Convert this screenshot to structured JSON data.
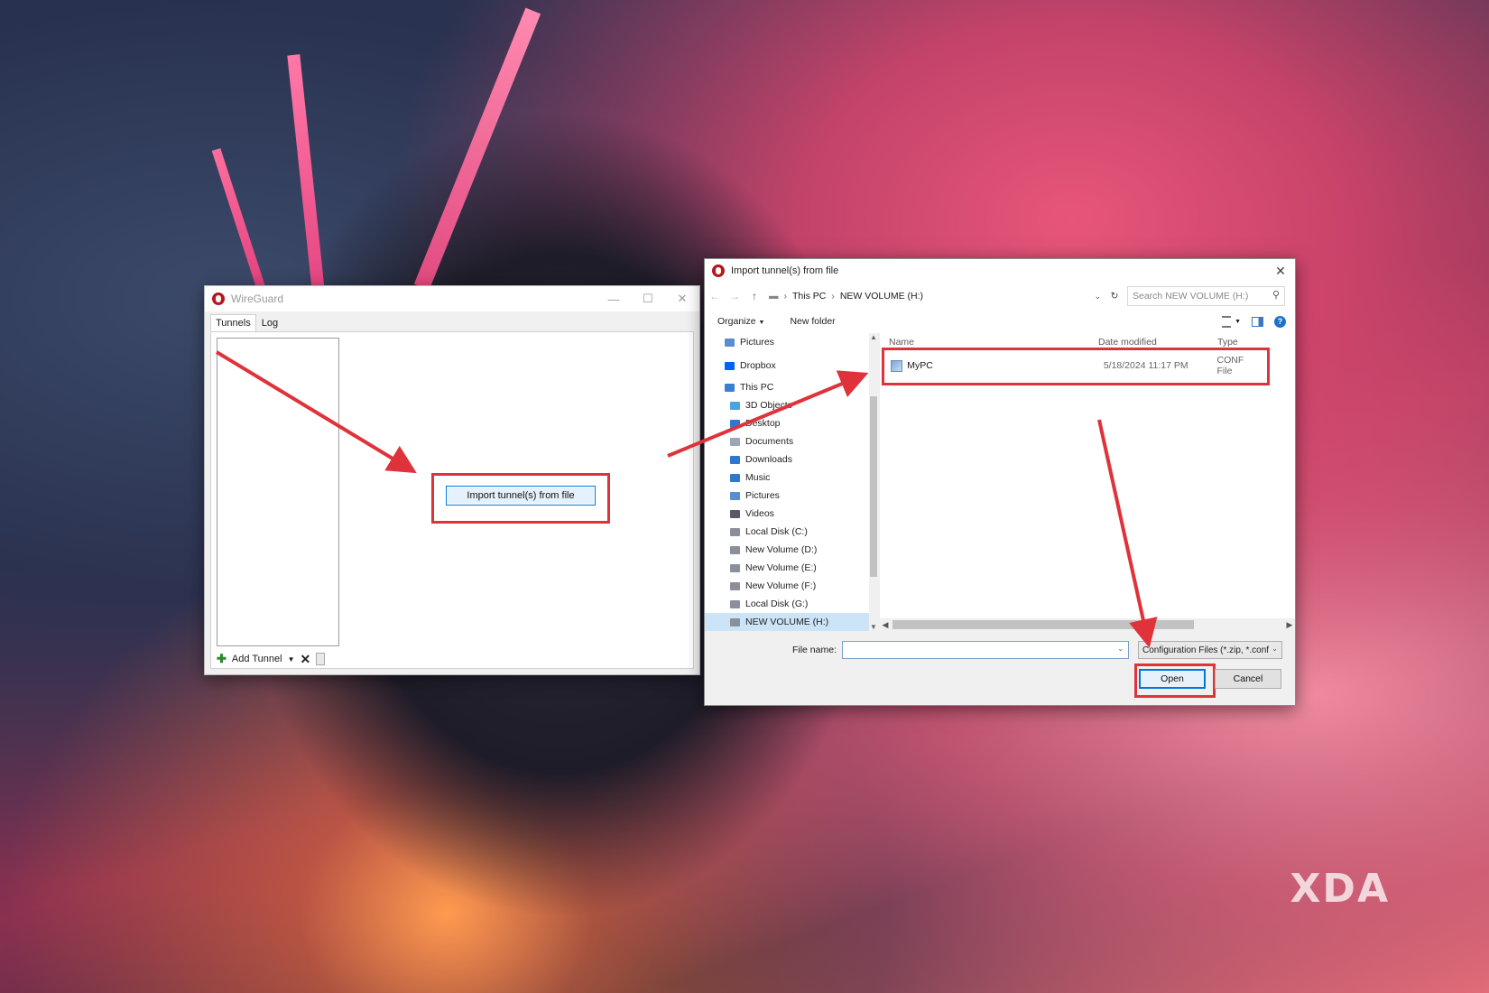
{
  "wireguard": {
    "title": "WireGuard",
    "tabs": [
      "Tunnels",
      "Log"
    ],
    "import_button": "Import tunnel(s) from file",
    "add_tunnel": "Add Tunnel"
  },
  "dialog": {
    "title": "Import tunnel(s) from file",
    "breadcrumb": [
      "This PC",
      "NEW VOLUME (H:)"
    ],
    "search_placeholder": "Search NEW VOLUME (H:)",
    "organize": "Organize",
    "new_folder": "New folder",
    "nav_items": [
      {
        "label": "Pictures",
        "icon": "pictures-icon"
      },
      {
        "label": "Dropbox",
        "icon": "dropbox-icon"
      },
      {
        "label": "This PC",
        "icon": "pc-icon"
      },
      {
        "label": "3D Objects",
        "icon": "3d-objects-icon"
      },
      {
        "label": "Desktop",
        "icon": "desktop-icon"
      },
      {
        "label": "Documents",
        "icon": "documents-icon"
      },
      {
        "label": "Downloads",
        "icon": "downloads-icon"
      },
      {
        "label": "Music",
        "icon": "music-icon"
      },
      {
        "label": "Pictures",
        "icon": "pictures-icon"
      },
      {
        "label": "Videos",
        "icon": "videos-icon"
      },
      {
        "label": "Local Disk (C:)",
        "icon": "drive-icon"
      },
      {
        "label": "New Volume (D:)",
        "icon": "drive-icon"
      },
      {
        "label": "New Volume (E:)",
        "icon": "drive-icon"
      },
      {
        "label": "New Volume (F:)",
        "icon": "drive-icon"
      },
      {
        "label": "Local Disk (G:)",
        "icon": "drive-icon"
      },
      {
        "label": "NEW VOLUME (H:)",
        "icon": "drive-icon"
      }
    ],
    "columns": [
      "Name",
      "Date modified",
      "Type"
    ],
    "files": [
      {
        "name": "MyPC",
        "date": "5/18/2024 11:17 PM",
        "type": "CONF File"
      }
    ],
    "file_name_label": "File name:",
    "file_name_value": "",
    "file_type": "Configuration Files (*.zip, *.conf",
    "open_button": "Open",
    "cancel_button": "Cancel"
  },
  "watermark": "XDA",
  "colors": {
    "highlight": "#e0323a",
    "accent": "#0078d7"
  }
}
